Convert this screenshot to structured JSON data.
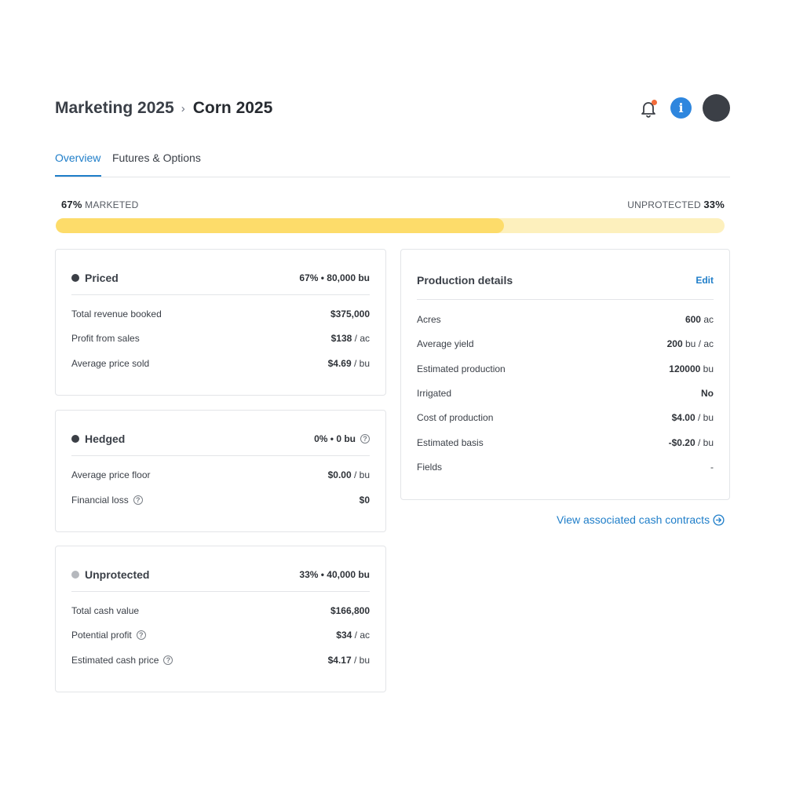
{
  "header": {
    "breadcrumb_parent": "Marketing 2025",
    "breadcrumb_separator": "›",
    "breadcrumb_current": "Corn 2025",
    "icons": [
      "bell-icon",
      "info-icon",
      "avatar"
    ],
    "info_glyph": "i"
  },
  "tabs": [
    {
      "label": "Overview",
      "active": true
    },
    {
      "label": "Futures & Options",
      "active": false
    }
  ],
  "progress": {
    "marketed_percent": "67%",
    "marketed_label": "MARKETED",
    "unprotected_label": "UNPROTECTED",
    "unprotected_percent": "33%",
    "marketed_fraction": 0.67
  },
  "priced": {
    "title": "Priced",
    "meta": "67% • 80,000 bu",
    "rows": [
      {
        "label": "Total revenue booked",
        "value": "$375,000",
        "unit": ""
      },
      {
        "label": "Profit from sales",
        "value": "$138",
        "unit": " / ac"
      },
      {
        "label": "Average price sold",
        "value": "$4.69",
        "unit": " / bu"
      }
    ]
  },
  "hedged": {
    "title": "Hedged",
    "meta": "0% • 0 bu",
    "rows": [
      {
        "label": "Average price floor",
        "value": "$0.00",
        "unit": " / bu"
      },
      {
        "label": "Financial loss",
        "value": "$0",
        "unit": ""
      }
    ]
  },
  "unprotected": {
    "title": "Unprotected",
    "meta": "33% • 40,000 bu",
    "rows": [
      {
        "label": "Total cash value",
        "value": "$166,800",
        "unit": ""
      },
      {
        "label": "Potential profit",
        "value": "$34",
        "unit": " / ac"
      },
      {
        "label": "Estimated cash price",
        "value": "$4.17",
        "unit": " / bu"
      }
    ]
  },
  "production": {
    "title": "Production details",
    "edit_label": "Edit",
    "rows": [
      {
        "label": "Acres",
        "value": "600",
        "unit": " ac"
      },
      {
        "label": "Average yield",
        "value": "200",
        "unit": " bu / ac"
      },
      {
        "label": "Estimated production",
        "value": "120000",
        "unit": " bu"
      },
      {
        "label": "Irrigated",
        "value": "No",
        "unit": ""
      },
      {
        "label": "Cost of production",
        "value": "$4.00",
        "unit": " / bu"
      },
      {
        "label": "Estimated basis",
        "value": "-$0.20",
        "unit": " / bu"
      },
      {
        "label": "Fields",
        "value": "-",
        "unit": ""
      }
    ]
  },
  "view_link": "View associated cash contracts",
  "help_glyph": "?",
  "colors": {
    "accent": "#1f7ec9",
    "progress_fill": "#fddc6a",
    "progress_track": "#fdf0bd",
    "dot_priced": "#3b3f46",
    "dot_hedged": "#3b3f46",
    "dot_unprotected": "#b5b8bd",
    "notification": "#f26b3a"
  }
}
